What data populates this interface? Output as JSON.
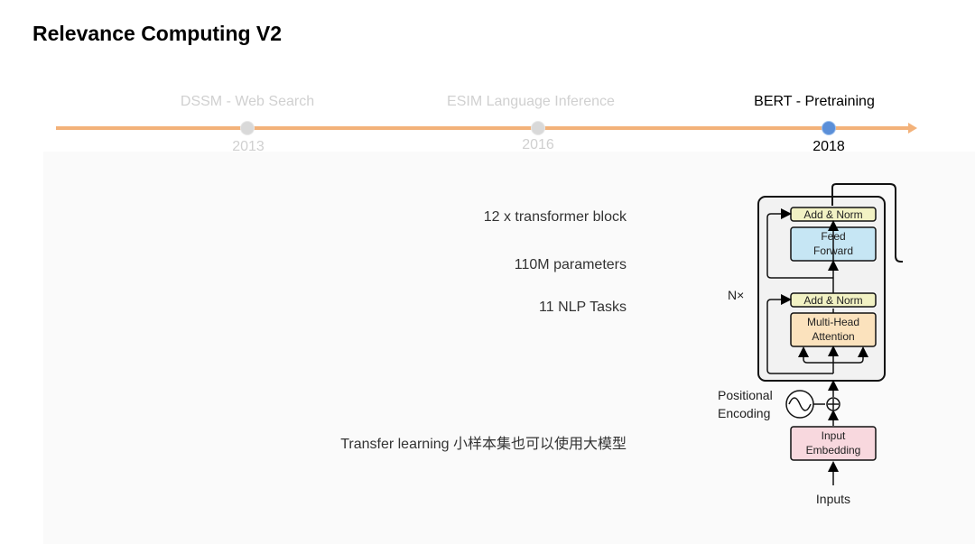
{
  "title": "Relevance Computing V2",
  "timeline": {
    "items": [
      {
        "label": "DSSM - Web Search",
        "year": "2013",
        "active": false
      },
      {
        "label": "ESIM  Language Inference",
        "year": "2016",
        "active": false
      },
      {
        "label": "BERT - Pretraining",
        "year": "2018",
        "active": true
      }
    ],
    "line_color": "#f3b27a",
    "active_color": "#5b8fd8"
  },
  "info": {
    "blocks": "12 x transformer block",
    "params": "110M parameters",
    "tasks": "11 NLP Tasks",
    "transfer": "Transfer learning  小样本集也可以使用大模型"
  },
  "architecture": {
    "add_norm_top": "Add & Norm",
    "feed_forward_1": "Feed",
    "feed_forward_2": "Forward",
    "add_norm_bottom": "Add & Norm",
    "attention_1": "Multi-Head",
    "attention_2": "Attention",
    "nx": "N×",
    "positional_1": "Positional",
    "positional_2": "Encoding",
    "embedding_1": "Input",
    "embedding_2": "Embedding",
    "inputs": "Inputs",
    "colors": {
      "add_norm": "#f2f2c4",
      "feed_forward": "#c6e6f4",
      "attention": "#fbe2bd",
      "embedding": "#f8d8de"
    }
  }
}
